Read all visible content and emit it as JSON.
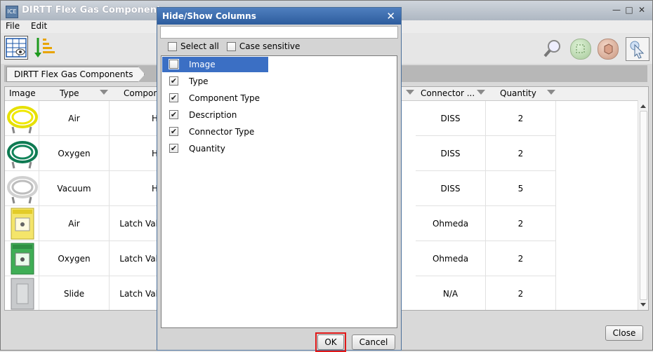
{
  "app": {
    "title": "DIRTT Flex Gas Components",
    "icon_text": "ICE",
    "menu": [
      "File",
      "Edit"
    ],
    "breadcrumb": "DIRTT Flex Gas Components",
    "close_label": "Close"
  },
  "table": {
    "headers": {
      "image": "Image",
      "type": "Type",
      "component": "Componer",
      "connector": "Connector ...",
      "quantity": "Quantity"
    },
    "rows": [
      {
        "image": "yellow-hose",
        "type": "Air",
        "component": "H",
        "connector": "DISS",
        "quantity": "2"
      },
      {
        "image": "green-hose",
        "type": "Oxygen",
        "component": "H",
        "connector": "DISS",
        "quantity": "2"
      },
      {
        "image": "white-hose",
        "type": "Vacuum",
        "component": "H",
        "connector": "DISS",
        "quantity": "5"
      },
      {
        "image": "air-valve-plate",
        "type": "Air",
        "component": "Latch Val",
        "connector": "Ohmeda",
        "quantity": "2"
      },
      {
        "image": "oxygen-valve-plate",
        "type": "Oxygen",
        "component": "Latch Val",
        "connector": "Ohmeda",
        "quantity": "2"
      },
      {
        "image": "slide-plate",
        "type": "Slide",
        "component": "Latch Val",
        "connector": "N/A",
        "quantity": "2"
      }
    ]
  },
  "dialog": {
    "title": "Hide/Show Columns",
    "search_value": "",
    "select_all_label": "Select all",
    "case_sensitive_label": "Case sensitive",
    "columns": [
      {
        "label": "Image",
        "checked": false,
        "selected": true
      },
      {
        "label": "Type",
        "checked": true,
        "selected": false
      },
      {
        "label": "Component Type",
        "checked": true,
        "selected": false
      },
      {
        "label": "Description",
        "checked": true,
        "selected": false
      },
      {
        "label": "Connector Type",
        "checked": true,
        "selected": false
      },
      {
        "label": "Quantity",
        "checked": true,
        "selected": false
      }
    ],
    "ok_label": "OK",
    "cancel_label": "Cancel"
  },
  "colors": {
    "selection": "#3b6fc4",
    "highlight": "#e01818",
    "dialog_title": "#2d5c9d"
  }
}
